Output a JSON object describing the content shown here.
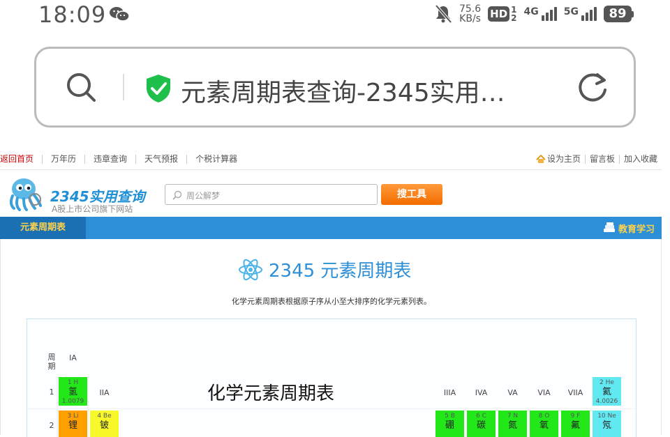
{
  "status_bar": {
    "time": "18:09",
    "net_speed_value": "75.6",
    "net_speed_unit": "KB/s",
    "hd_label": "HD",
    "sim1": "1",
    "sim2": "2",
    "net1": "4G",
    "net2": "5G",
    "battery": "89",
    "icons": [
      "wechat-icon",
      "mute-bell-icon",
      "signal-icon",
      "battery-icon"
    ]
  },
  "url_bar": {
    "title": "元素周期表查询-2345实用…",
    "icons": [
      "search-icon",
      "secure-shield-icon",
      "reload-icon"
    ]
  },
  "top_nav": {
    "left": [
      "返回首页",
      "万年历",
      "违章查询",
      "天气预报",
      "个税计算器"
    ],
    "right": [
      "设为主页",
      "留言板",
      "加入收藏"
    ]
  },
  "header": {
    "brand": "2345实用查询",
    "subtitle": "A股上市公司旗下网站",
    "search_placeholder": "周公解梦",
    "search_button": "搜工具"
  },
  "blue_bar": {
    "tab": "元素周期表",
    "right_link": "教育学习"
  },
  "page": {
    "title": "2345 元素周期表",
    "description": "化学元素周期表根据原子序从小至大排序的化学元素列表。"
  },
  "periodic_table": {
    "caption": "化学元素周期表",
    "period_header": "周\n期",
    "group_headers": {
      "IA": "IA",
      "IIA": "IIA",
      "IIIA": "IIIA",
      "IVA": "IVA",
      "VA": "VA",
      "VIA": "VIA",
      "VIIA": "VIIA"
    },
    "row_labels": [
      "1",
      "2"
    ],
    "elements": {
      "H": {
        "sym": "1 H",
        "name": "氢",
        "mass": "1.0079"
      },
      "He": {
        "sym": "2 He",
        "name": "氦",
        "mass": "4.0026"
      },
      "Li": {
        "sym": "3 Li",
        "name": "锂"
      },
      "Be": {
        "sym": "4 Be",
        "name": "铍"
      },
      "B": {
        "sym": "5 B",
        "name": "硼"
      },
      "C": {
        "sym": "6 C",
        "name": "碳"
      },
      "N": {
        "sym": "7 N",
        "name": "氮"
      },
      "O": {
        "sym": "8 O",
        "name": "氧"
      },
      "F": {
        "sym": "9 F",
        "name": "氟"
      },
      "Ne": {
        "sym": "10 Ne",
        "name": "氖"
      }
    },
    "colors": {
      "nonmetal": "#22e81a",
      "alkali": "#ff9f00",
      "alkaline_earth": "#f7f92b",
      "noble_gas": "#61e9f2",
      "accent_blue": "#2d8fd7"
    }
  }
}
